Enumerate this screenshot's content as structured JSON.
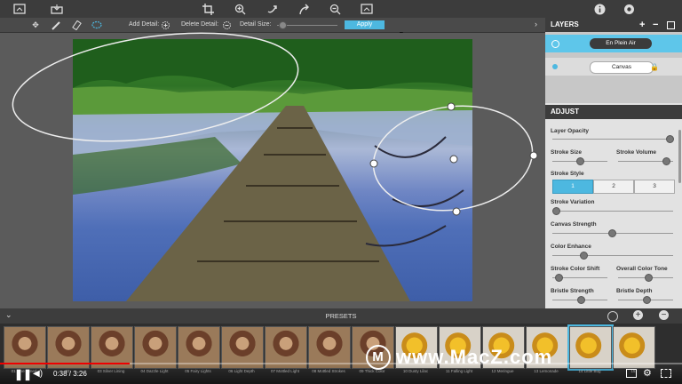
{
  "topbar": {
    "icons": [
      "frame-icon",
      "save-icon",
      "crop-icon",
      "zoom-in-icon",
      "undo-icon",
      "redo-icon",
      "zoom-out-icon",
      "fit-icon",
      "info-icon",
      "settings-icon"
    ]
  },
  "detail_toolbar": {
    "add_detail_label": "Add Detail:",
    "delete_detail_label": "Delete Detail:",
    "detail_size_label": "Detail Size:",
    "detail_size_value": 0.0,
    "apply_label": "Apply"
  },
  "layers": {
    "title": "LAYERS",
    "items": [
      {
        "name": "En Plein Air",
        "active": true
      },
      {
        "name": "Canvas",
        "active": false,
        "locked": true
      }
    ]
  },
  "adjust": {
    "title": "ADJUST",
    "layer_opacity_label": "Layer Opacity",
    "layer_opacity_value": 0.97,
    "stroke_size_label": "Stroke Size",
    "stroke_size_value": 0.45,
    "stroke_volume_label": "Stroke Volume",
    "stroke_volume_value": 0.9,
    "stroke_style_label": "Stroke Style",
    "stroke_style_options": [
      "1",
      "2",
      "3"
    ],
    "stroke_style_selected": "1",
    "stroke_variation_label": "Stroke Variation",
    "stroke_variation_value": 0.0,
    "canvas_strength_label": "Canvas Strength",
    "canvas_strength_value": 0.5,
    "color_enhance_label": "Color Enhance",
    "color_enhance_value": 0.25,
    "stroke_color_shift_label": "Stroke Color Shift",
    "stroke_color_shift_value": 0.1,
    "overall_color_tone_label": "Overall Color Tone",
    "overall_color_tone_value": 0.55,
    "bristle_strength_label": "Bristle Strength",
    "bristle_strength_value": 0.5,
    "bristle_depth_label": "Bristle Depth",
    "bristle_depth_value": 0.5
  },
  "presets": {
    "title": "PRESETS",
    "items": [
      {
        "label": "01 Fine Tuned"
      },
      {
        "label": "02"
      },
      {
        "label": "03 Silver Lining"
      },
      {
        "label": "04 Dazzle Light"
      },
      {
        "label": "05 Fairy Lights"
      },
      {
        "label": "06 Light Depth"
      },
      {
        "label": "07 Mottled Light"
      },
      {
        "label": "08 Mottled Strokes"
      },
      {
        "label": "09 Thick Color"
      },
      {
        "label": "10 Dusty Lilac"
      },
      {
        "label": "11 Falling Light"
      },
      {
        "label": "12 Meringue"
      },
      {
        "label": "13 Lemonade"
      },
      {
        "label": "14 Little Bug"
      },
      {
        "label": "15"
      }
    ]
  },
  "video": {
    "time": "0:38 / 3:26",
    "progress": 0.19
  },
  "watermark": {
    "text": "www.MacZ.com"
  },
  "colors": {
    "accent": "#4db8e0",
    "dark": "#3c3c3c",
    "panel": "#e2e2e2"
  }
}
